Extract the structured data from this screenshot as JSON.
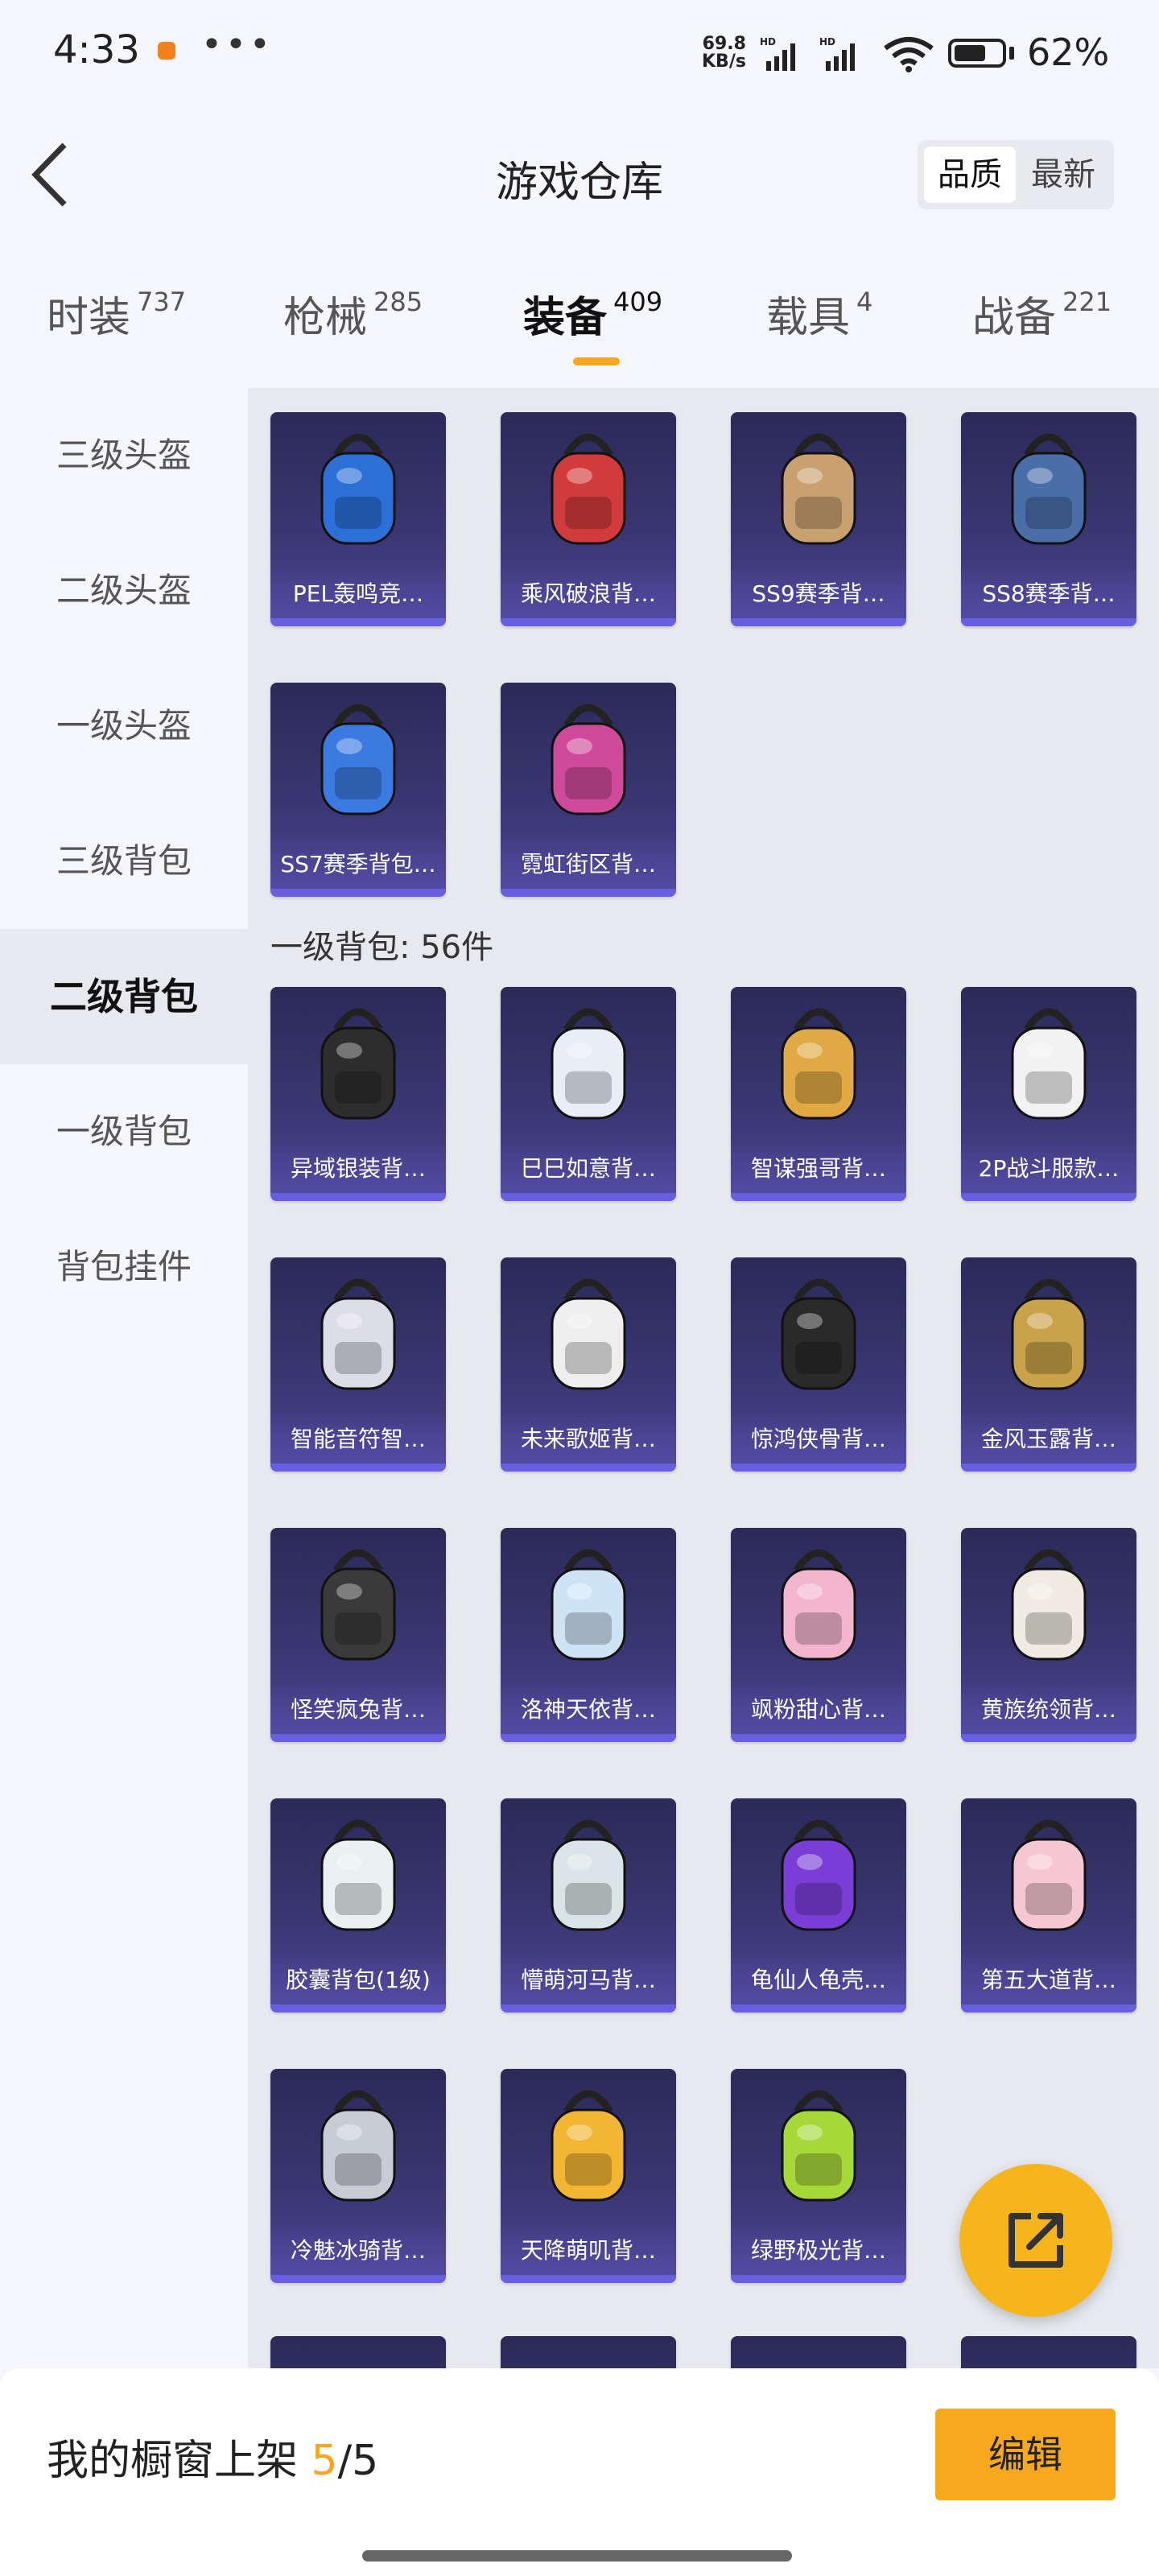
{
  "status_bar": {
    "time": "4:33",
    "net_speed_top": "69.8",
    "net_speed_bottom": "KB/s",
    "battery": "62%"
  },
  "header": {
    "title": "游戏仓库",
    "sort_quality": "品质",
    "sort_latest": "最新"
  },
  "tabs": [
    {
      "label": "时装",
      "count": "737"
    },
    {
      "label": "枪械",
      "count": "285"
    },
    {
      "label": "装备",
      "count": "409"
    },
    {
      "label": "载具",
      "count": "4"
    },
    {
      "label": "战备",
      "count": "221"
    }
  ],
  "sidebar": {
    "items": [
      "三级头盔",
      "二级头盔",
      "一级头盔",
      "三级背包",
      "二级背包",
      "一级背包",
      "背包挂件"
    ]
  },
  "section_tier2": {
    "items": [
      "PEL轰鸣竞…",
      "乘风破浪背…",
      "SS9赛季背…",
      "SS8赛季背…",
      "SS7赛季背包…",
      "霓虹街区背…"
    ]
  },
  "section_tier1": {
    "label": "一级背包: 56件",
    "items": [
      "异域银装背…",
      "巳巳如意背…",
      "智谋强哥背…",
      "2P战斗服款…",
      "智能音符智…",
      "未来歌姬背…",
      "惊鸿侠骨背…",
      "金风玉露背…",
      "怪笑疯兔背…",
      "洛神天依背…",
      "飒粉甜心背…",
      "黄族统领背…",
      "胶囊背包(1级)",
      "懵萌河马背…",
      "龟仙人龟壳…",
      "第五大道背…",
      "冷魅冰骑背…",
      "天降萌叽背…",
      "绿野极光背…"
    ]
  },
  "bottom_bar": {
    "label": "我的橱窗上架",
    "current": "5",
    "total": "/5",
    "edit": "编辑"
  },
  "colors": {
    "accent": "#f5a623",
    "card_bg": "#3a3672",
    "card_bar": "#6a5ee0"
  }
}
